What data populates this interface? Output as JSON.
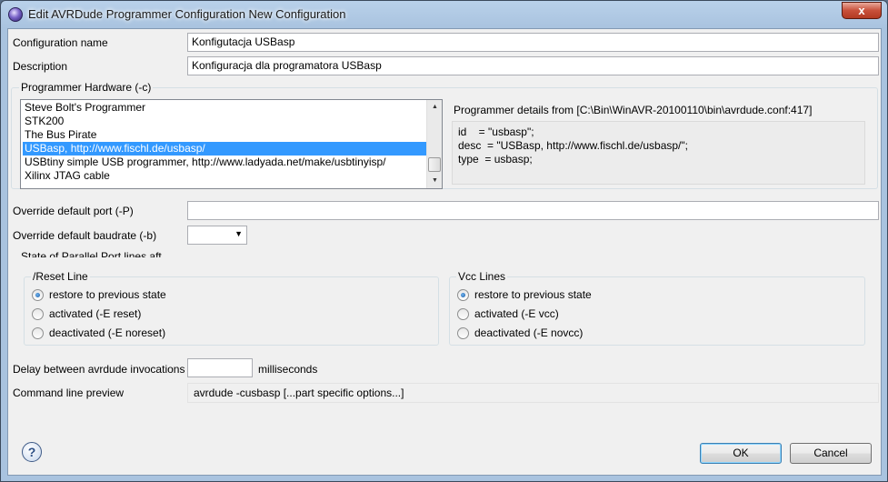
{
  "window": {
    "title": "Edit AVRDude Programmer Configuration New Configuration",
    "close_glyph": "x"
  },
  "config_name": {
    "label": "Configuration name",
    "value": "Konfigutacja USBasp"
  },
  "description": {
    "label": "Description",
    "value": "Konfiguracja dla programatora USBasp"
  },
  "hardware": {
    "group_title": "Programmer Hardware (-c)",
    "items": [
      "Steve Bolt's Programmer",
      "STK200",
      "The Bus Pirate",
      "USBasp, http://www.fischl.de/usbasp/",
      "USBtiny simple USB programmer, http://www.ladyada.net/make/usbtinyisp/",
      "Xilinx JTAG cable"
    ],
    "selected_index": 3
  },
  "details": {
    "header": "Programmer details from [C:\\Bin\\WinAVR-20100110\\bin\\avrdude.conf:417]",
    "lines": [
      "id    = \"usbasp\";",
      "desc  = \"USBasp, http://www.fischl.de/usbasp/\";",
      "type  = usbasp;"
    ]
  },
  "override_port": {
    "label": "Override default port (-P)",
    "value": ""
  },
  "override_baudrate": {
    "label": "Override default baudrate (-b)",
    "value": ""
  },
  "parallel_state_label": "State of Parallel Port lines aft",
  "reset_line": {
    "title": "/Reset Line",
    "options": [
      "restore to previous state",
      "activated (-E reset)",
      "deactivated (-E noreset)"
    ],
    "selected_index": 0
  },
  "vcc_lines": {
    "title": "Vcc Lines",
    "options": [
      "restore to previous state",
      "activated (-E vcc)",
      "deactivated (-E novcc)"
    ],
    "selected_index": 0
  },
  "delay": {
    "label": "Delay between avrdude invocations",
    "value": "",
    "unit": "milliseconds"
  },
  "preview": {
    "label": "Command line preview",
    "value": "avrdude -cusbasp  [...part specific options...]"
  },
  "buttons": {
    "ok": "OK",
    "cancel": "Cancel",
    "help_glyph": "?"
  }
}
